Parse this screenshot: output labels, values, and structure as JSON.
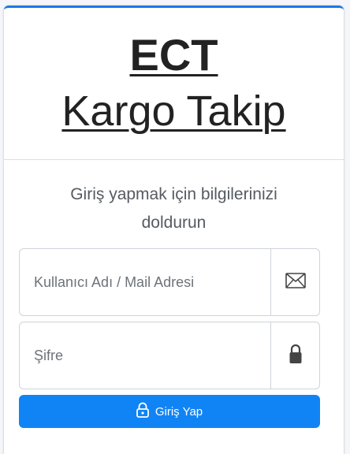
{
  "brand": {
    "line1": "ECT",
    "line2": "Kargo Takip"
  },
  "login": {
    "message": "Giriş yapmak için bilgilerinizi doldurun",
    "username": {
      "placeholder": "Kullanıcı Adı / Mail Adresi",
      "value": "",
      "icon": "envelope-icon"
    },
    "password": {
      "placeholder": "Şifre",
      "value": "",
      "icon": "lock-icon"
    },
    "submit_label": "Giriş Yap",
    "submit_icon": "lock-icon"
  },
  "colors": {
    "accent": "#1184f5",
    "card_top_border": "#1a7ae8",
    "text_dark": "#222222",
    "text_muted": "#555b61"
  }
}
